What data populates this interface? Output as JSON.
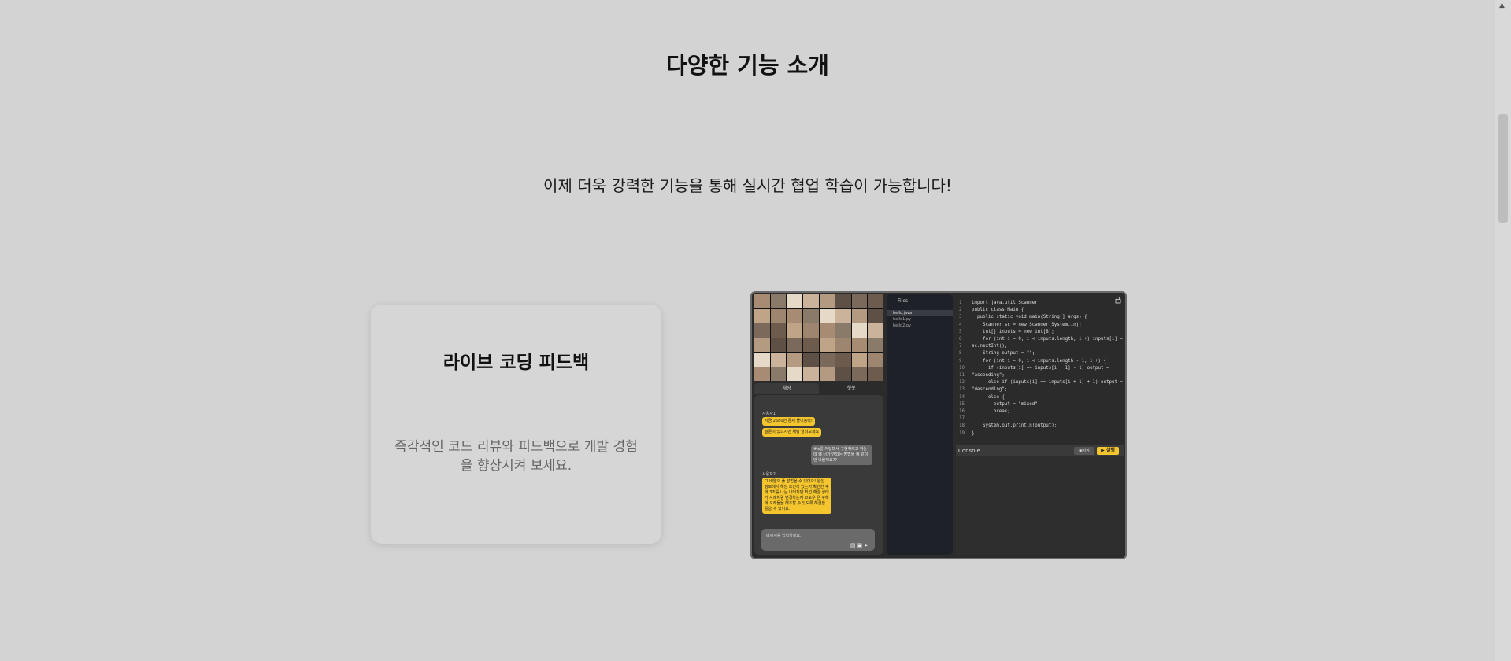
{
  "section": {
    "title": "다양한 기능 소개",
    "subtitle": "이제 더욱 강력한 기능을 통해 실시간 협업 학습이 가능합니다!"
  },
  "feature_card": {
    "title": "라이브 코딩 피드백",
    "description": "즉각적인 코드 리뷰와 피드백으로 개발 경험을 향상시켜 보세요."
  },
  "preview": {
    "tabs": [
      "채팅",
      "챗봇"
    ],
    "chat": {
      "sender_1": "사용자1",
      "msg_1": "지금 2580번 문제 풀이능력!",
      "msg_2": "질문이 있으시면 채팅 알려보세요",
      "reply": "#is를 어딜봐서 구현하려고 하는데 왜 너가 안되는 방법을 해 같이 안 나올까요??",
      "sender_2": "사용자2",
      "msg_3": "그 배열의 풀 방법을 수 있어요! 원인 정보에서 해당 조건이 있는지 확인한 후에 3조를 나는 나머지만 최선 해결 상태가 사례처럼 변경하는지 고도우 은 구해에 오래들을 해조할 수 있도록 해결한 풀을 수 있어요.",
      "input_placeholder": "메세지를 입력하세요."
    },
    "files": {
      "header": "Files",
      "items": [
        "hello.java",
        "hello1.py",
        "hello2.py"
      ]
    },
    "code": [
      "import java.util.Scanner;",
      "public class Main {",
      "  public static void main(String[] args) {",
      "    Scanner sc = new Scanner(System.in);",
      "    int[] inputs = new int[8];",
      "    for (int i = 0; i < inputs.length; i++) inputs[i] =",
      "sc.nextInt();",
      "    String output = \"\";",
      "    for (int i = 0; i < inputs.length - 1; i++) {",
      "      if (inputs[i] == inputs[i + 1] - 1) output =",
      "\"ascending\";",
      "      else if (inputs[i] == inputs[i + 1] + 1) output =",
      "\"descending\";",
      "      else {",
      "        output = \"mixed\";",
      "        break;",
      "",
      "    System.out.println(output);",
      "}"
    ],
    "console_label": "Console",
    "save_label": "저장",
    "run_label": "▶ 실행"
  },
  "colors": {
    "page_bg": "#d3d3d3",
    "accent_yellow": "#f4c52c",
    "editor_bg": "#2b2b2b"
  }
}
